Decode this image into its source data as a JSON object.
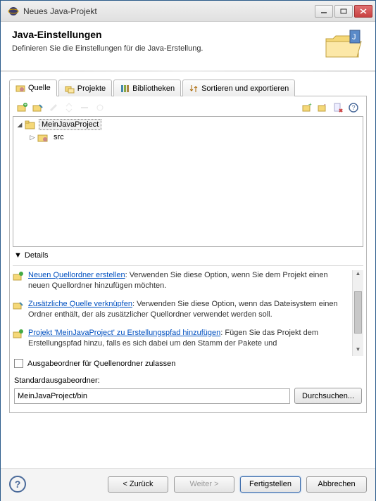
{
  "window": {
    "title": "Neues Java-Projekt"
  },
  "header": {
    "title": "Java-Einstellungen",
    "description": "Definieren Sie die Einstellungen für die Java-Erstellung."
  },
  "tabs": {
    "source": "Quelle",
    "projects": "Projekte",
    "libraries": "Bibliotheken",
    "order": "Sortieren und exportieren"
  },
  "tree": {
    "project": "MeinJavaProject",
    "src": "src"
  },
  "details": {
    "heading": "Details",
    "item1_link": "Neuen Quellordner erstellen",
    "item1_text": ": Verwenden Sie diese Option, wenn Sie dem Projekt einen neuen Quellordner hinzufügen möchten.",
    "item2_link": "Zusätzliche Quelle verknüpfen",
    "item2_text": ": Verwenden Sie diese Option, wenn das Dateisystem einen Ordner enthält, der als zusätzlicher Quellordner verwendet werden soll.",
    "item3_link": "Projekt 'MeinJavaProject' zu Erstellungspfad hinzufügen",
    "item3_text": ": Fügen Sie das Projekt dem Erstellungspfad hinzu, falls es sich dabei um den Stamm der Pakete und"
  },
  "checkbox_label": "Ausgabeordner für Quellenordner zulassen",
  "output": {
    "label": "Standardausgabeordner:",
    "value": "MeinJavaProject/bin",
    "browse": "Durchsuchen..."
  },
  "footer": {
    "back": "< Zurück",
    "next": "Weiter >",
    "finish": "Fertigstellen",
    "cancel": "Abbrechen"
  }
}
